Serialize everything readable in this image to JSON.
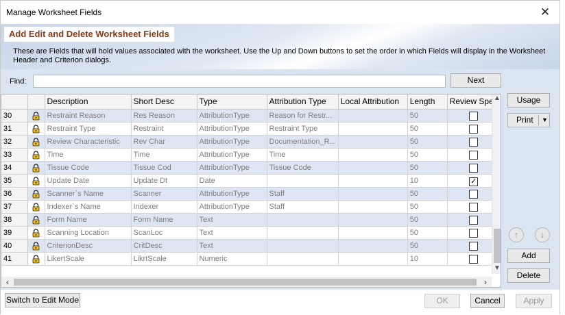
{
  "window": {
    "title": "Manage Worksheet Fields",
    "close_glyph": "✕"
  },
  "header": {
    "title": "Add Edit and Delete Worksheet Fields",
    "description": "These are Fields that will hold values associated with the worksheet. Use the Up and Down buttons to set the order in which Fields will display in the Worksheet Header and Criterion dialogs."
  },
  "find": {
    "label": "Find:",
    "value": "",
    "next_label": "Next"
  },
  "grid": {
    "columns": [
      "",
      "",
      "Description",
      "Short Desc",
      "Type",
      "Attribution Type",
      "Local Attribution",
      "Length",
      "Review Spec"
    ],
    "rows": [
      {
        "num": "30",
        "description": "Restraint Reason",
        "short": "Res Reason",
        "type": "AttributionType",
        "attr_type": "Reason for Restr...",
        "local": "",
        "length": "50",
        "checked": false
      },
      {
        "num": "31",
        "description": "Restraint Type",
        "short": "Restraint",
        "type": "AttributionType",
        "attr_type": "Restraint Type",
        "local": "",
        "length": "50",
        "checked": false
      },
      {
        "num": "32",
        "description": "Review Characteristic",
        "short": "Rev Char",
        "type": "AttributionType",
        "attr_type": "Documentation_R...",
        "local": "",
        "length": "50",
        "checked": false
      },
      {
        "num": "33",
        "description": "Time",
        "short": "Time",
        "type": "AttributionType",
        "attr_type": "Time",
        "local": "",
        "length": "50",
        "checked": false
      },
      {
        "num": "34",
        "description": "Tissue Code",
        "short": "Tissue Cod",
        "type": "AttributionType",
        "attr_type": "Tissue Code",
        "local": "",
        "length": "50",
        "checked": false
      },
      {
        "num": "35",
        "description": "Update Date",
        "short": "Update Dt",
        "type": "Date",
        "attr_type": "",
        "local": "",
        "length": "10",
        "checked": true
      },
      {
        "num": "36",
        "description": "Scanner`s Name",
        "short": "Scanner",
        "type": "AttributionType",
        "attr_type": "Staff",
        "local": "",
        "length": "50",
        "checked": false
      },
      {
        "num": "37",
        "description": "Indexer`s Name",
        "short": "Indexer",
        "type": "AttributionType",
        "attr_type": "Staff",
        "local": "",
        "length": "50",
        "checked": false
      },
      {
        "num": "38",
        "description": "Form Name",
        "short": "Form Name",
        "type": "Text",
        "attr_type": "",
        "local": "",
        "length": "50",
        "checked": false
      },
      {
        "num": "39",
        "description": "Scanning Location",
        "short": "ScanLoc",
        "type": "Text",
        "attr_type": "",
        "local": "",
        "length": "50",
        "checked": false
      },
      {
        "num": "40",
        "description": "CriterionDesc",
        "short": "CritDesc",
        "type": "Text",
        "attr_type": "",
        "local": "",
        "length": "50",
        "checked": false
      },
      {
        "num": "41",
        "description": "LikertScale",
        "short": "LikrtScale",
        "type": "Numeric",
        "attr_type": "",
        "local": "",
        "length": "10",
        "checked": false
      }
    ]
  },
  "side": {
    "usage_label": "Usage",
    "print_label": "Print",
    "add_label": "Add",
    "delete_label": "Delete"
  },
  "footer": {
    "edit_mode_label": "Switch to Edit Mode",
    "ok_label": "OK",
    "cancel_label": "Cancel",
    "apply_label": "Apply"
  },
  "icons": {
    "row_icon": "lock-icon",
    "move_up": "arrow-up-circle-icon",
    "move_down": "arrow-down-circle-icon"
  },
  "colors": {
    "header_title_text": "#8a3a16",
    "alt_row_bg": "#dfe6f3",
    "pane_bg": "#dbe4f1"
  }
}
